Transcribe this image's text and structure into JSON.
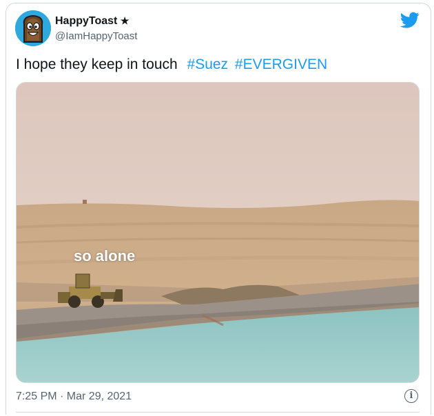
{
  "author": {
    "display_name": "HappyToast",
    "badge": "★",
    "handle": "@IamHappyToast",
    "avatar_icon": "toast-avatar-icon"
  },
  "platform_icon": "twitter-bird-icon",
  "tweet": {
    "text": "I hope they keep in touch",
    "hashtags": [
      "#Suez",
      "#EVERGIVEN"
    ]
  },
  "media": {
    "caption_overlay": "so alone"
  },
  "timestamp": "7:25 PM · Mar 29, 2021",
  "info_icon": "info-icon",
  "colors": {
    "link": "#1d9bf0",
    "text": "#0f1419",
    "secondary": "#536471",
    "border": "#cfd9de"
  }
}
